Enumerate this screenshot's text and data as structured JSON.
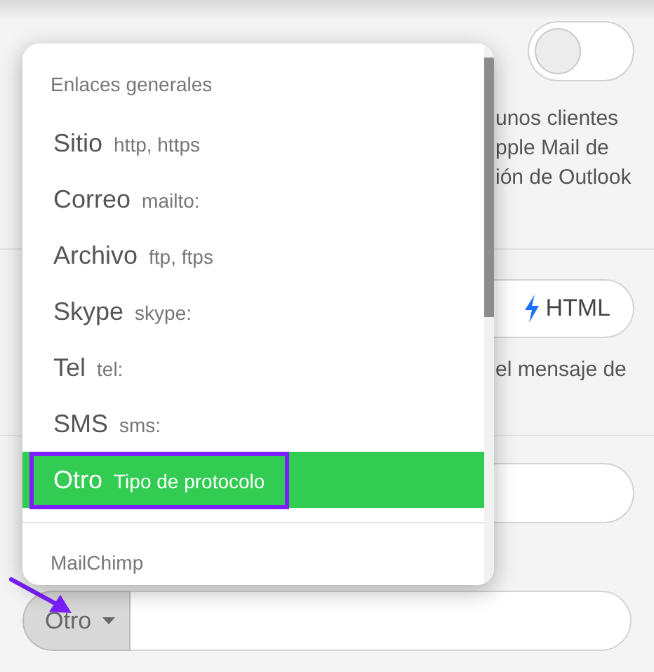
{
  "settings": {
    "toggle": {
      "on": false
    },
    "description_lines": [
      "unos clientes",
      "pple Mail de",
      "ión de Outlook"
    ],
    "html_button": "HTML",
    "note": "el mensaje de"
  },
  "link_field": {
    "type_button": "Otro"
  },
  "menu": {
    "sections": [
      {
        "title": "Enlaces generales",
        "items": [
          {
            "label": "Sitio",
            "hint": "http, https",
            "selected": false
          },
          {
            "label": "Correo",
            "hint": "mailto:",
            "selected": false
          },
          {
            "label": "Archivo",
            "hint": "ftp, ftps",
            "selected": false
          },
          {
            "label": "Skype",
            "hint": "skype:",
            "selected": false
          },
          {
            "label": "Tel",
            "hint": "tel:",
            "selected": false
          },
          {
            "label": "SMS",
            "hint": "sms:",
            "selected": false
          },
          {
            "label": "Otro",
            "hint": "Tipo de protocolo",
            "selected": true
          }
        ]
      },
      {
        "title": "MailChimp"
      }
    ]
  }
}
